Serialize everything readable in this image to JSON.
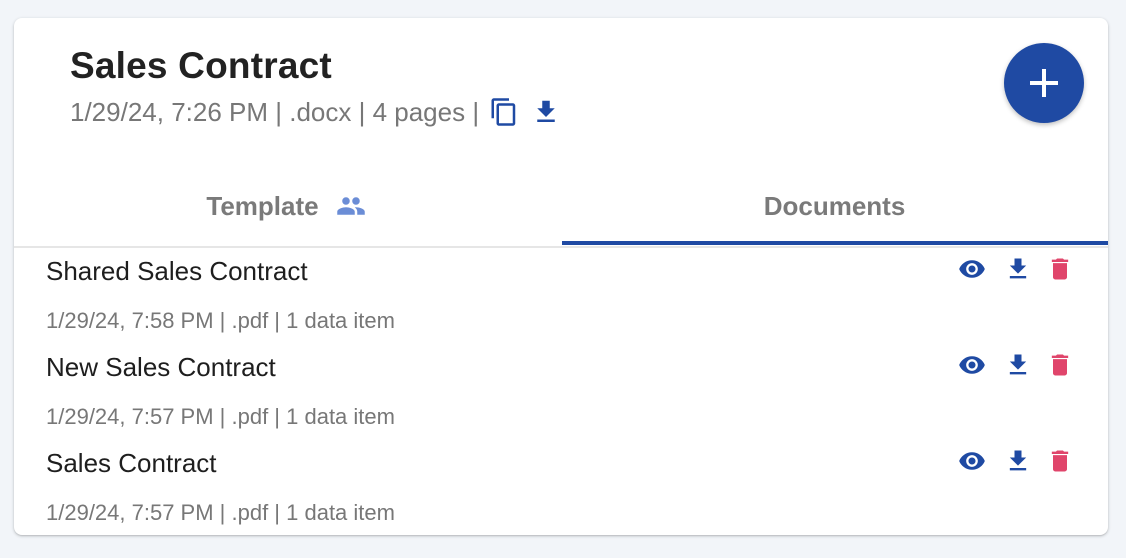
{
  "header": {
    "title": "Sales Contract",
    "meta": "1/29/24, 7:26 PM | .docx | 4 pages |",
    "icons": [
      "copy-icon",
      "download-icon"
    ],
    "add_button_icon": "plus-icon"
  },
  "tabs": [
    {
      "label": "Template",
      "icon": "people-icon",
      "active": false
    },
    {
      "label": "Documents",
      "active": true
    }
  ],
  "documents": [
    {
      "name": "Shared Sales Contract",
      "meta": "1/29/24, 7:58 PM | .pdf | 1 data item"
    },
    {
      "name": "New Sales Contract",
      "meta": "1/29/24, 7:57 PM | .pdf | 1 data item"
    },
    {
      "name": "Sales Contract",
      "meta": "1/29/24, 7:57 PM | .pdf | 1 data item"
    }
  ],
  "colors": {
    "primary": "#1f4aa3",
    "delete": "#e0456b",
    "tab_icon": "#6b8dd6",
    "muted_text": "#777777"
  }
}
